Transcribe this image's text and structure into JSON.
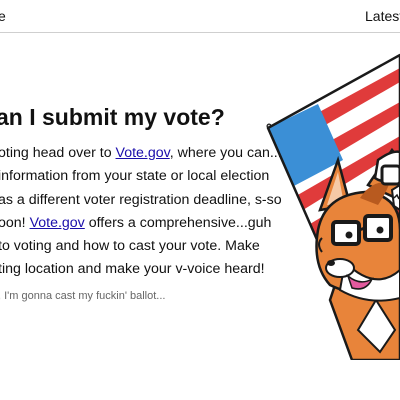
{
  "header": {
    "left_text": "e",
    "nav_latest": "Latest"
  },
  "article": {
    "heading": "an I submit my vote?",
    "line1_pre": "oting head over to ",
    "line1_link": "Vote.gov",
    "line1_post": ", where you can...",
    "line2": "information from your state or local election",
    "line3": "as a different voter registration deadline, s-so",
    "line4_pre": "oon! ",
    "line4_link": "Vote.gov",
    "line4_post": " offers a comprehensive...guh",
    "line5": "to voting and how to cast your vote. Make",
    "line6": "ting location and make your v-voice heard!",
    "caption": ", I'm gonna cast my fuckin' ballot..."
  },
  "illustration": {
    "icon": "flag-mascot-icon",
    "colors": {
      "flag_red": "#e03b3b",
      "flag_blue": "#3b8fd6",
      "fur_orange": "#e8843a",
      "outline": "#1a1a1a"
    }
  }
}
